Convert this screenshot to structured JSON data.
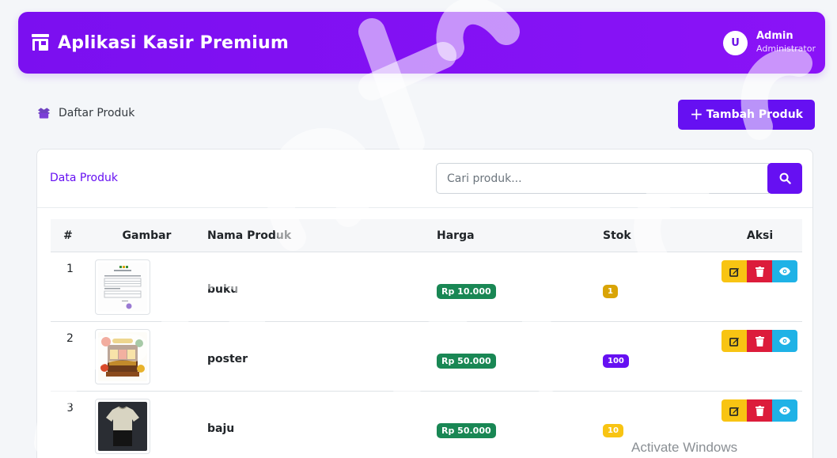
{
  "app": {
    "title": "Aplikasi Kasir Premium",
    "brand_icon": "store-icon"
  },
  "user": {
    "initial": "U",
    "name": "Admin",
    "role": "Administrator"
  },
  "breadcrumb": {
    "icon": "box-open-icon",
    "label": "Daftar Produk"
  },
  "toolbar": {
    "add_icon": "plus-icon",
    "add_label": "Tambah Produk"
  },
  "card": {
    "title": "Data Produk"
  },
  "search": {
    "placeholder": "Cari produk...",
    "value": "",
    "icon": "search-icon"
  },
  "table": {
    "headers": {
      "no": "#",
      "image": "Gambar",
      "name": "Nama Produk",
      "price": "Harga",
      "stock": "Stok",
      "actions": "Aksi"
    },
    "rows": [
      {
        "no": "1",
        "name": "buku",
        "price": "Rp 10.000",
        "stock": "1",
        "stock_color": "#d9a406",
        "image_icon": "document-thumbnail"
      },
      {
        "no": "2",
        "name": "poster",
        "price": "Rp 50.000",
        "stock": "100",
        "stock_color": "#6610f2",
        "image_icon": "poster-thumbnail"
      },
      {
        "no": "3",
        "name": "baju",
        "price": "Rp 50.000",
        "stock": "10",
        "stock_color": "#f8c413",
        "image_icon": "tshirt-thumbnail"
      }
    ]
  },
  "colors": {
    "primary": "#6610f2",
    "header_gradient": "#7b0ff0",
    "price_badge": "#198754",
    "edit": "#f8c413",
    "delete": "#dc1c3b",
    "view": "#1fb2e6"
  },
  "watermark": {
    "activate_text": "Activate Windows"
  }
}
